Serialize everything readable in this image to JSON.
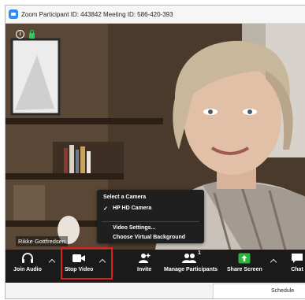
{
  "window": {
    "title": "Zoom Participant ID: 443842   Meeting ID: 586-420-393"
  },
  "participant": {
    "name": "Rikke Gottfredsen"
  },
  "camera_menu": {
    "header": "Select a Camera",
    "checkmark": "✓",
    "selected_camera": "HP HD Camera",
    "video_settings": "Video Settings...",
    "virtual_background": "Choose Virtual Background"
  },
  "toolbar": {
    "join_audio": "Join Audio",
    "stop_video": "Stop Video",
    "invite": "Invite",
    "manage_participants": "Manage Participants",
    "participant_count": "1",
    "share_screen": "Share Screen",
    "chat": "Chat"
  },
  "side_panel": {
    "schedule": "Schedule"
  },
  "colors": {
    "toolbar_bg": "#1a1a1a",
    "share_green": "#2eb43c",
    "highlight_red": "#e02020",
    "zoom_blue": "#2d8cff"
  }
}
